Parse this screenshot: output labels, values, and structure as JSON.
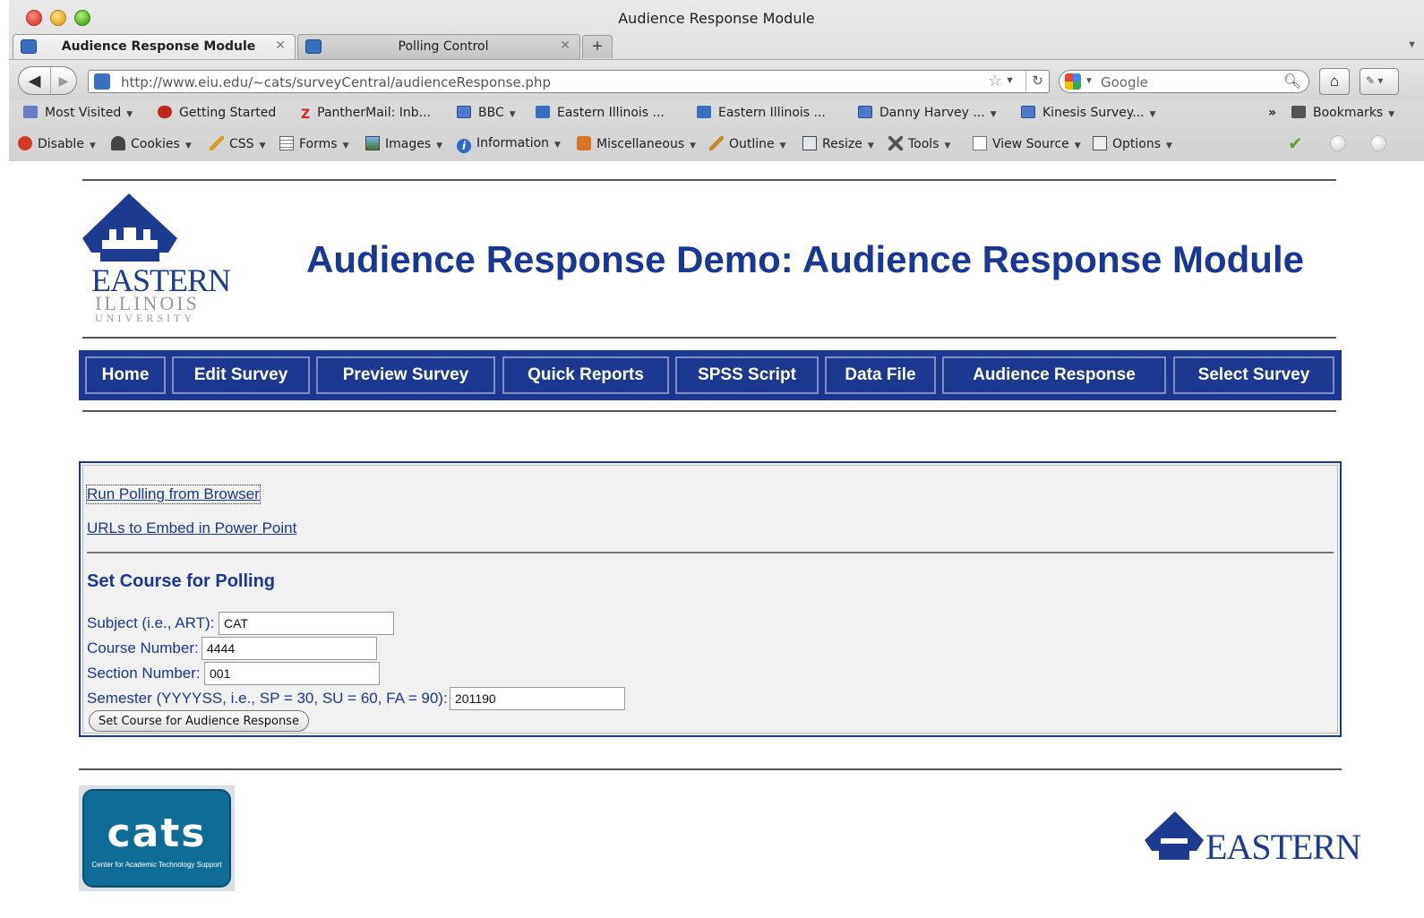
{
  "window": {
    "title": "Audience Response Module"
  },
  "tabs": [
    {
      "label": "Audience Response Module",
      "active": true
    },
    {
      "label": "Polling Control",
      "active": false
    }
  ],
  "navigation": {
    "url": "http://www.eiu.edu/~cats/surveyCentral/audienceResponse.php",
    "search_placeholder": "Google"
  },
  "bookmarks": [
    {
      "label": "Most Visited",
      "dropdown": true,
      "icon": "folder-icon"
    },
    {
      "label": "Getting Started",
      "dropdown": false,
      "icon": "firefox-icon"
    },
    {
      "label": "PantherMail: Inb...",
      "dropdown": false,
      "icon": "zimbra-icon"
    },
    {
      "label": "BBC",
      "dropdown": true,
      "icon": "feed-icon"
    },
    {
      "label": "Eastern Illinois ...",
      "dropdown": false,
      "icon": "site-icon"
    },
    {
      "label": "Eastern Illinois ...",
      "dropdown": false,
      "icon": "site-icon"
    },
    {
      "label": "Danny Harvey ...",
      "dropdown": true,
      "icon": "feed-icon"
    },
    {
      "label": "Kinesis Survey...",
      "dropdown": true,
      "icon": "feed-icon"
    }
  ],
  "bookmarks_menu": {
    "overflow": "»",
    "label": "Bookmarks"
  },
  "webdev_toolbar": [
    {
      "label": "Disable",
      "icon": "disable-icon"
    },
    {
      "label": "Cookies",
      "icon": "cookies-icon"
    },
    {
      "label": "CSS",
      "icon": "css-icon"
    },
    {
      "label": "Forms",
      "icon": "forms-icon"
    },
    {
      "label": "Images",
      "icon": "images-icon"
    },
    {
      "label": "Information",
      "icon": "information-icon"
    },
    {
      "label": "Miscellaneous",
      "icon": "miscellaneous-icon"
    },
    {
      "label": "Outline",
      "icon": "outline-icon"
    },
    {
      "label": "Resize",
      "icon": "resize-icon"
    },
    {
      "label": "Tools",
      "icon": "tools-icon"
    },
    {
      "label": "View Source",
      "icon": "view-source-icon"
    },
    {
      "label": "Options",
      "icon": "options-icon"
    }
  ],
  "header": {
    "logo": {
      "line1": "EASTERN",
      "line2": "ILLINOIS",
      "line3": "UNIVERSITY"
    },
    "title": "Audience Response Demo: Audience Response Module"
  },
  "menu": [
    {
      "label": "Home"
    },
    {
      "label": "Edit Survey"
    },
    {
      "label": "Preview Survey"
    },
    {
      "label": "Quick Reports"
    },
    {
      "label": "SPSS Script"
    },
    {
      "label": "Data File"
    },
    {
      "label": "Audience Response"
    },
    {
      "label": "Select Survey"
    }
  ],
  "panel": {
    "links": [
      {
        "label": "Run Polling from Browser"
      },
      {
        "label": "URLs to Embed in Power Point"
      }
    ],
    "section_title": "Set Course for Polling",
    "fields": [
      {
        "label": "Subject (i.e., ART):",
        "value": "CAT"
      },
      {
        "label": "Course Number:",
        "value": "4444"
      },
      {
        "label": "Section Number:",
        "value": "001"
      },
      {
        "label": "Semester (YYYYSS, i.e., SP = 30, SU = 60, FA = 90):",
        "value": "201190"
      }
    ],
    "submit_label": "Set Course for Audience Response"
  },
  "footer": {
    "cats_word": "cats",
    "cats_subtitle": "Center for Academic Technology Support",
    "eastern_word": "EASTERN"
  },
  "colors": {
    "brand_blue": "#1c3890",
    "title_blue": "#1a3795",
    "panel_bg": "#f1f1f1",
    "cats_teal": "#0f6c96"
  }
}
